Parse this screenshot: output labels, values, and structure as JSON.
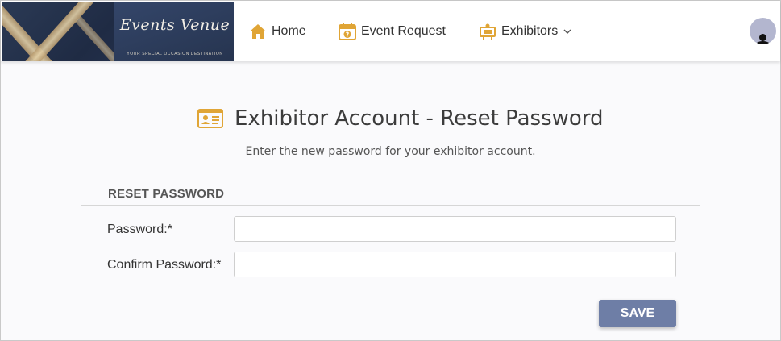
{
  "brand": {
    "logo_script": "Events Venue",
    "logo_tagline": "YOUR SPECIAL OCCASION DESTINATION",
    "accent_color": "#e0a536"
  },
  "nav": {
    "home_label": "Home",
    "home_icon": "home-icon",
    "event_request_label": "Event Request",
    "event_request_icon": "calendar-question-icon",
    "exhibitors_label": "Exhibitors",
    "exhibitors_icon": "exhibitor-booth-icon"
  },
  "page": {
    "title": "Exhibitor Account - Reset Password",
    "title_icon": "id-card-icon",
    "subtitle": "Enter the new password for your exhibitor account."
  },
  "form": {
    "section_title": "RESET PASSWORD",
    "password_label": "Password:*",
    "password_value": "",
    "confirm_label": "Confirm Password:*",
    "confirm_value": "",
    "save_label": "SAVE",
    "save_color": "#6e7ea6"
  }
}
